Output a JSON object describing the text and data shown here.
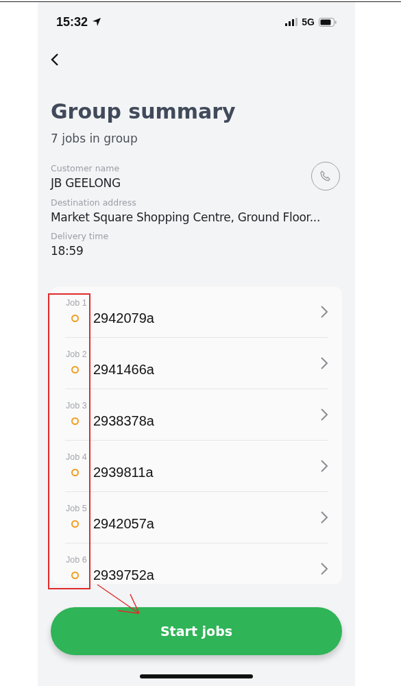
{
  "status_bar": {
    "time": "15:32",
    "network": "5G"
  },
  "title": "Group summary",
  "subtitle": "7 jobs in group",
  "fields": [
    {
      "label": "Customer name",
      "value": "JB GEELONG",
      "kind": "phone"
    },
    {
      "label": "Destination address",
      "value": "Market Square Shopping Centre, Ground Floor...",
      "kind": "plain"
    },
    {
      "label": "Delivery time",
      "value": "18:59",
      "kind": "plain"
    }
  ],
  "jobs": [
    {
      "label": "Job 1",
      "number": "2942079a"
    },
    {
      "label": "Job 2",
      "number": "2941466a"
    },
    {
      "label": "Job 3",
      "number": "2938378a"
    },
    {
      "label": "Job 4",
      "number": "2939811a"
    },
    {
      "label": "Job 5",
      "number": "2942057a"
    },
    {
      "label": "Job 6",
      "number": "2939752a"
    }
  ],
  "primary_button": "Start jobs"
}
